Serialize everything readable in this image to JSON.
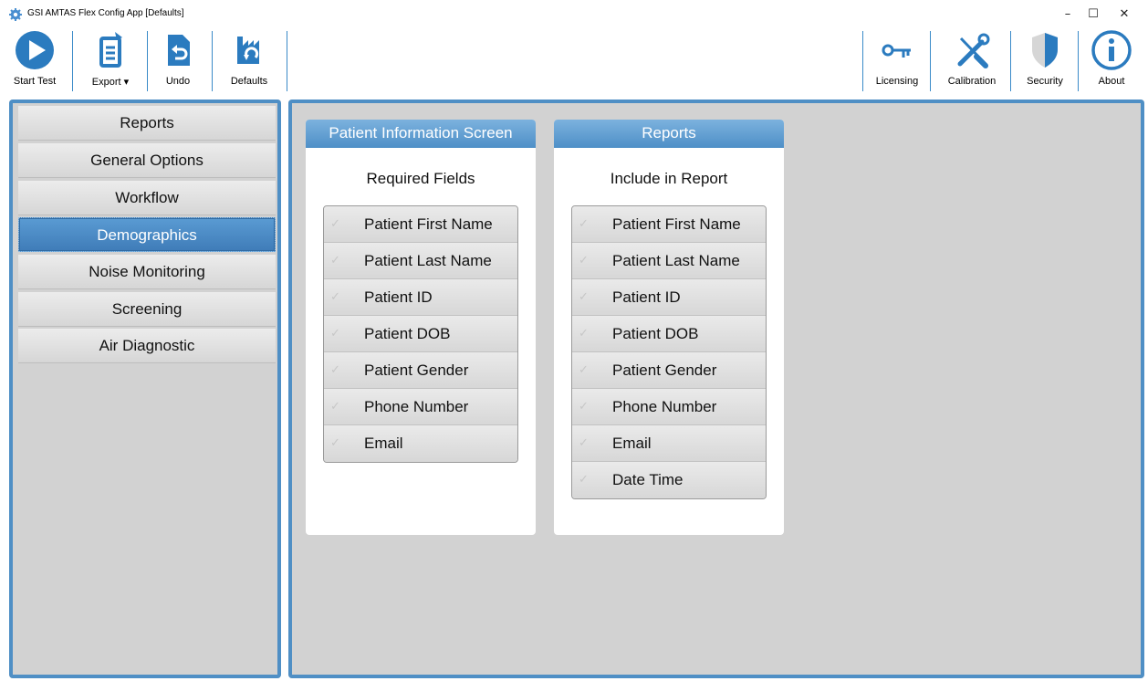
{
  "window": {
    "title": "GSI AMTAS Flex Config App [Defaults]",
    "minimize": "–",
    "maximize": "☐",
    "close": "✕"
  },
  "toolbar": {
    "start_test": "Start Test",
    "export": "Export",
    "export_caret": "▾",
    "undo": "Undo",
    "defaults": "Defaults",
    "licensing": "Licensing",
    "calibration": "Calibration",
    "security": "Security",
    "about": "About"
  },
  "sidebar": {
    "items": [
      {
        "label": "Reports"
      },
      {
        "label": "General Options"
      },
      {
        "label": "Workflow"
      },
      {
        "label": "Demographics"
      },
      {
        "label": "Noise Monitoring"
      },
      {
        "label": "Screening"
      },
      {
        "label": "Air Diagnostic"
      }
    ],
    "active_index": 3
  },
  "patient_card": {
    "header": "Patient Information Screen",
    "subtitle": "Required Fields",
    "fields": [
      "Patient First Name",
      "Patient Last Name",
      "Patient ID",
      "Patient DOB",
      "Patient Gender",
      "Phone Number",
      "Email"
    ]
  },
  "reports_card": {
    "header": "Reports",
    "subtitle": "Include in Report",
    "fields": [
      "Patient First Name",
      "Patient Last Name",
      "Patient ID",
      "Patient DOB",
      "Patient Gender",
      "Phone Number",
      "Email",
      "Date Time"
    ]
  },
  "colors": {
    "accent": "#4f8fc5",
    "panel_bg": "#d2d2d2",
    "icon_blue": "#2b7bbf"
  },
  "icons": {
    "check": "✓"
  }
}
